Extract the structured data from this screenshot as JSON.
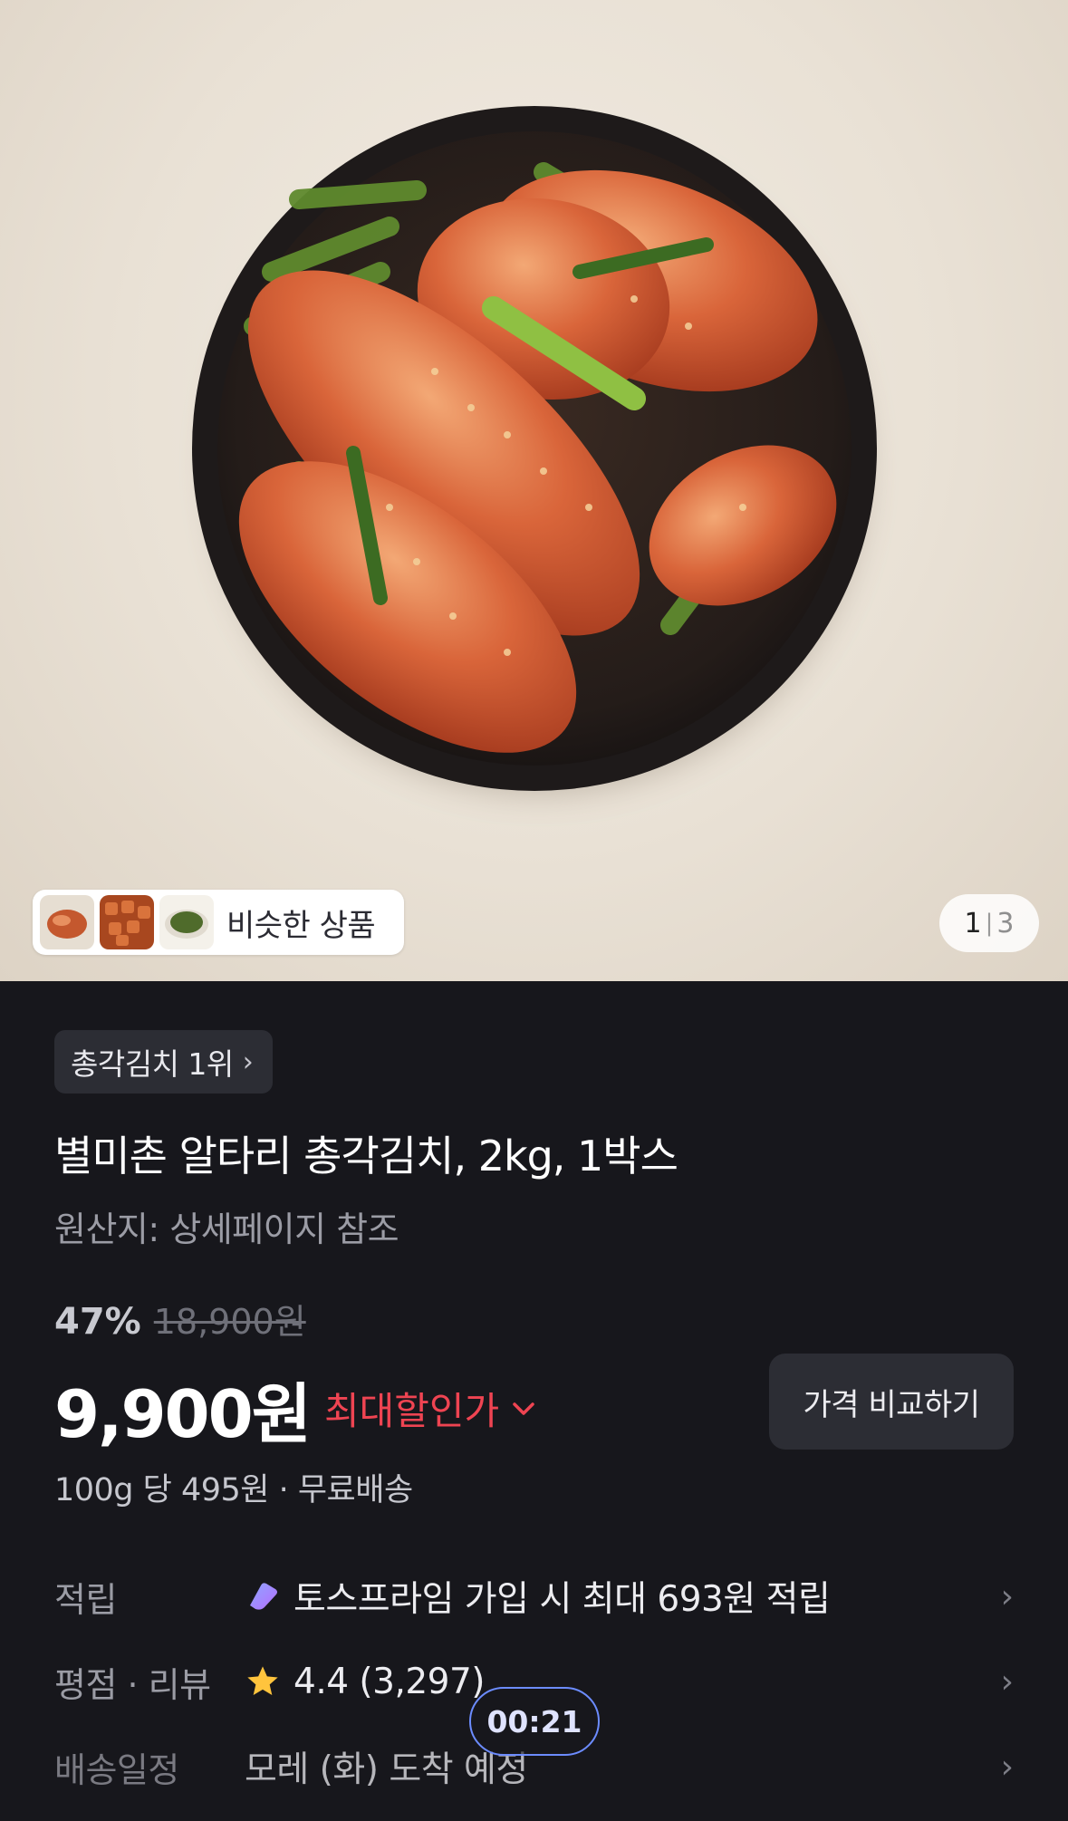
{
  "hero": {
    "image_alt": "food-photo",
    "similar_products_label": "비슷한 상품",
    "page_current": "1",
    "page_total": "3"
  },
  "product": {
    "rank_badge": "총각김치 1위",
    "title": "별미촌 알타리 총각김치, 2kg, 1박스",
    "origin": "원산지: 상세페이지 참조",
    "discount_rate": "47%",
    "original_price": "18,900원",
    "price": "9,900원",
    "max_discount_label": "최대할인가",
    "compare_button": "가격 비교하기",
    "unit_price": "100g 당 495원 · 무료배송"
  },
  "info_rows": {
    "point_label": "적립",
    "point_value": "토스프라임 가입 시 최대 693원 적립",
    "review_label": "평점 · 리뷰",
    "review_value": "4.4 (3,297)",
    "ship_label": "배송일정",
    "ship_value": "모레 (화) 도착 예정"
  },
  "timer": "00:21",
  "colors": {
    "background": "#17171c",
    "accent_red": "#ef4452",
    "badge_bg": "#2c2d34",
    "star": "#ffc43d"
  },
  "icons": [
    "chevron-right-icon",
    "chevron-down-icon",
    "toss-prime-icon",
    "star-icon"
  ]
}
